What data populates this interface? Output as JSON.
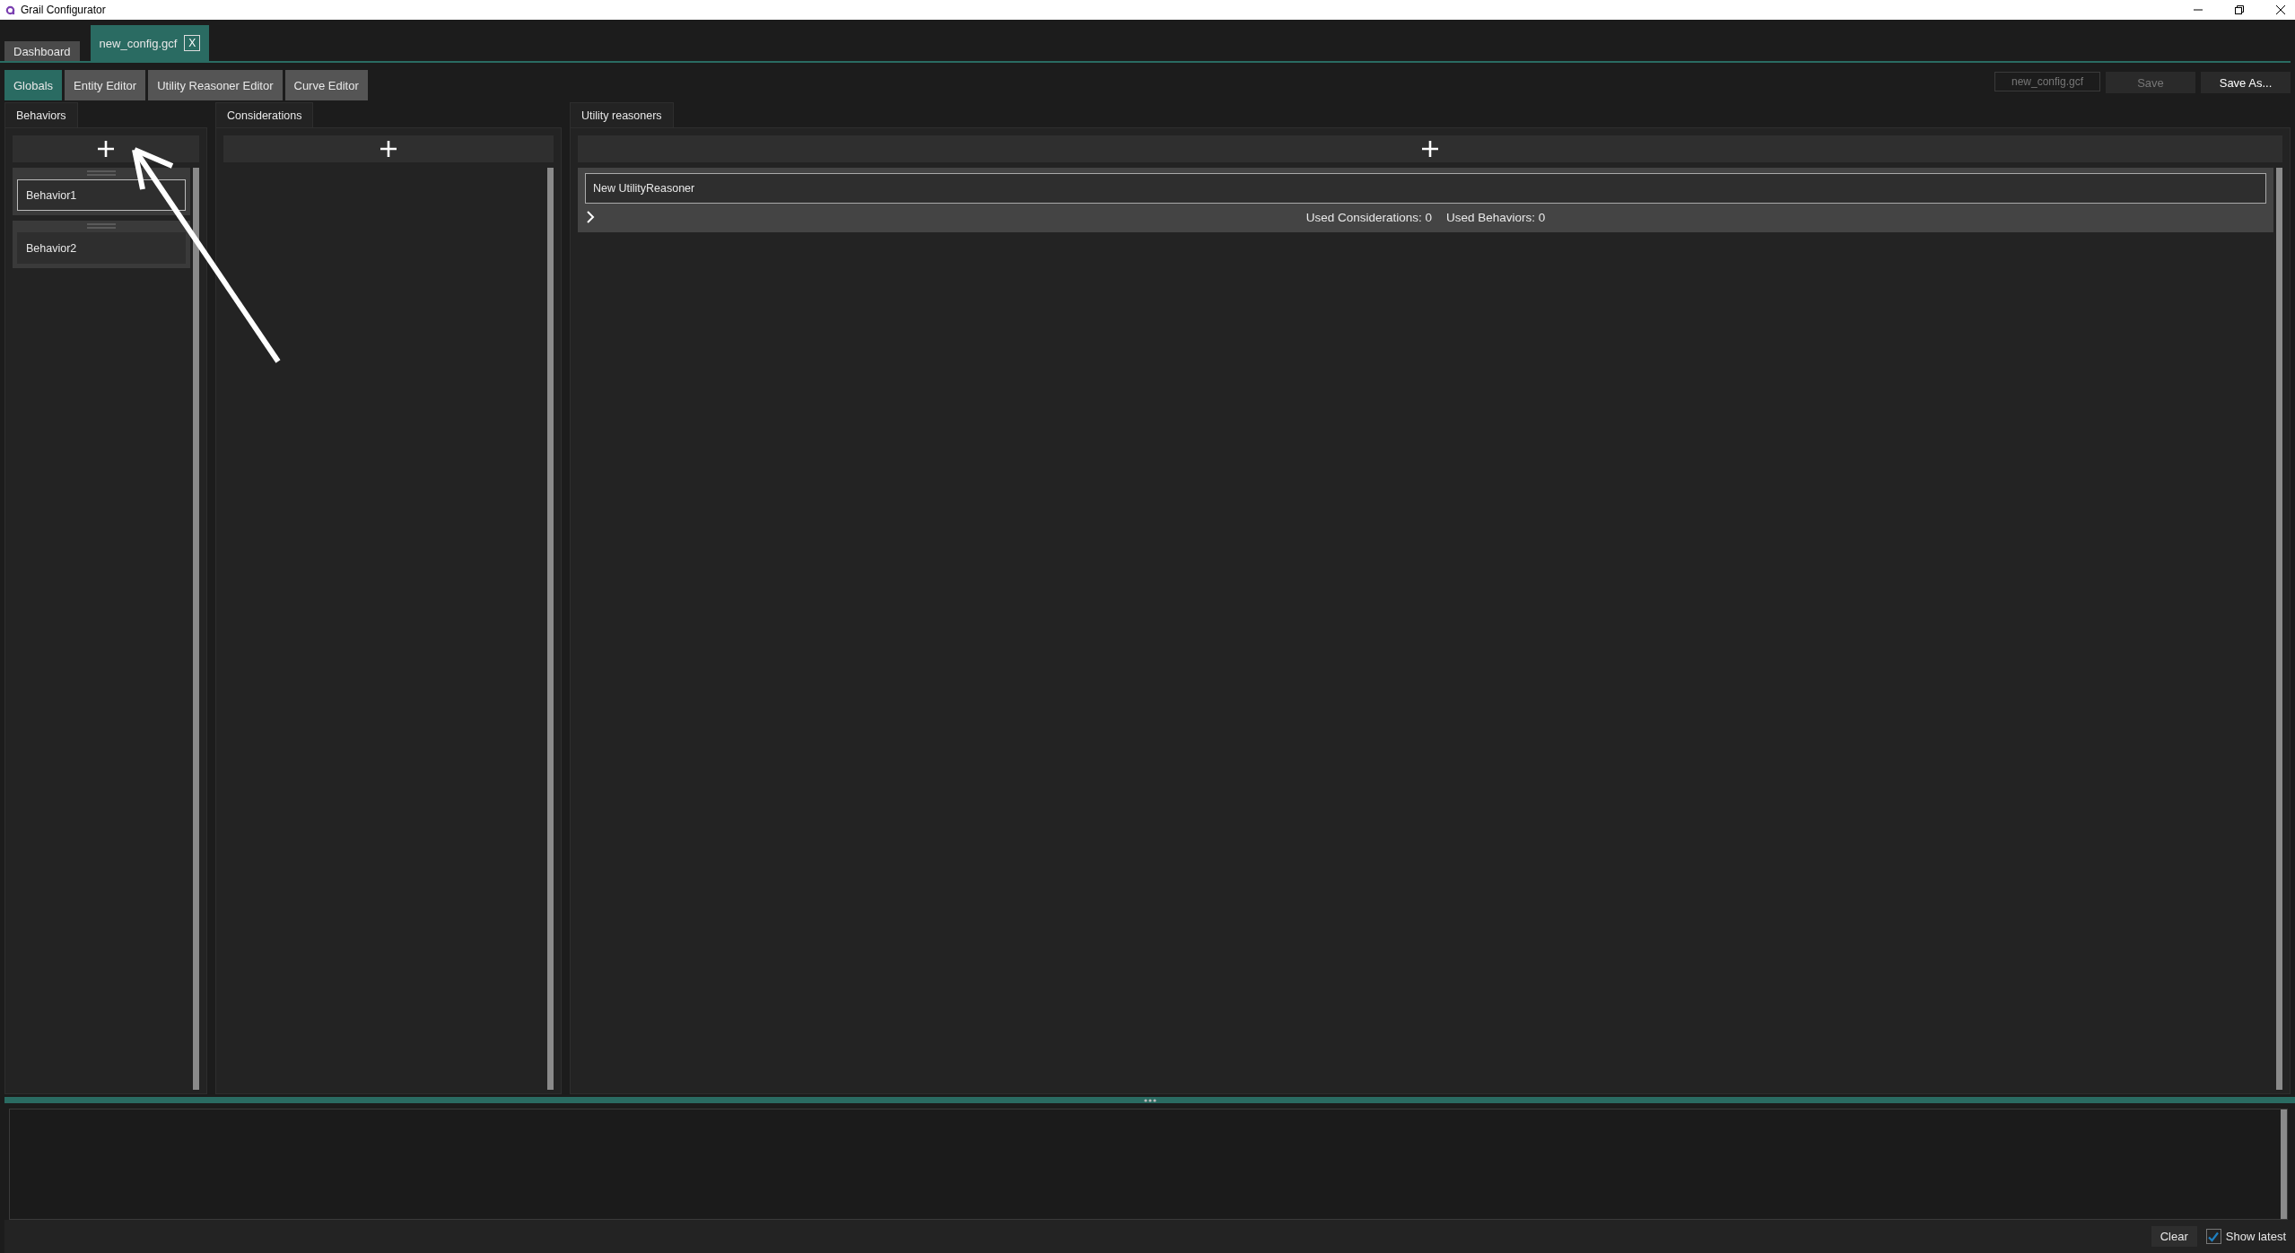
{
  "window": {
    "title": "Grail Configurator"
  },
  "document_tabs": [
    {
      "label": "Dashboard",
      "selected": false
    },
    {
      "label": "new_config.gcf",
      "selected": true,
      "close": "X"
    }
  ],
  "editor_tabs": [
    {
      "label": "Globals",
      "selected": true
    },
    {
      "label": "Entity Editor",
      "selected": false
    },
    {
      "label": "Utility Reasoner Editor",
      "selected": false
    },
    {
      "label": "Curve Editor",
      "selected": false
    }
  ],
  "file_field": {
    "value": "new_config.gcf",
    "disabled": true
  },
  "file_buttons": [
    {
      "label": "Save",
      "disabled": true
    },
    {
      "label": "Save As...",
      "disabled": false
    }
  ],
  "behaviors": {
    "tab": "Behaviors",
    "items": [
      {
        "name": "Behavior1",
        "selected": true
      },
      {
        "name": "Behavior2",
        "selected": false
      }
    ]
  },
  "considerations": {
    "tab": "Considerations"
  },
  "utility_reasoners": {
    "tab": "Utility reasoners",
    "reasoners": [
      {
        "name": "New UtilityReasoner",
        "expanded": false,
        "used_considerations": "Used Considerations: 0",
        "used_behaviors": "Used Behaviors: 0"
      }
    ]
  },
  "log": {
    "clear": "Clear",
    "show_latest": {
      "label": "Show latest",
      "checked": true
    }
  }
}
